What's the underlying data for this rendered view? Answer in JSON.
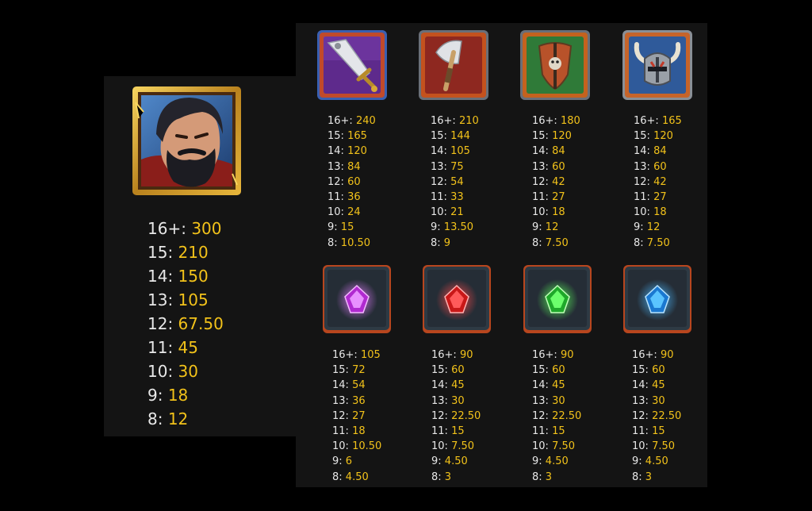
{
  "colors": {
    "background": "#000000",
    "panel": "#141414",
    "count_text": "#e8e8e8",
    "value_text": "#f2c21a"
  },
  "warrior": {
    "icon": "bearded-warrior-icon",
    "rows": [
      [
        "16+:",
        "300"
      ],
      [
        "15:",
        "210"
      ],
      [
        "14:",
        "150"
      ],
      [
        "13:",
        "105"
      ],
      [
        "12:",
        "67.50"
      ],
      [
        "11:",
        "45"
      ],
      [
        "10:",
        "30"
      ],
      [
        "9:",
        "18"
      ],
      [
        "8:",
        "12"
      ]
    ]
  },
  "top_symbols": [
    {
      "icon": "sword-icon",
      "rows": [
        [
          "16+:",
          "240"
        ],
        [
          "15:",
          "165"
        ],
        [
          "14:",
          "120"
        ],
        [
          "13:",
          "84"
        ],
        [
          "12:",
          "60"
        ],
        [
          "11:",
          "36"
        ],
        [
          "10:",
          "24"
        ],
        [
          "9:",
          "15"
        ],
        [
          "8:",
          "10.50"
        ]
      ]
    },
    {
      "icon": "axe-icon",
      "rows": [
        [
          "16+:",
          "210"
        ],
        [
          "15:",
          "144"
        ],
        [
          "14:",
          "105"
        ],
        [
          "13:",
          "75"
        ],
        [
          "12:",
          "54"
        ],
        [
          "11:",
          "33"
        ],
        [
          "10:",
          "21"
        ],
        [
          "9:",
          "13.50"
        ],
        [
          "8:",
          "9"
        ]
      ]
    },
    {
      "icon": "shield-icon",
      "rows": [
        [
          "16+:",
          "180"
        ],
        [
          "15:",
          "120"
        ],
        [
          "14:",
          "84"
        ],
        [
          "13:",
          "60"
        ],
        [
          "12:",
          "42"
        ],
        [
          "11:",
          "27"
        ],
        [
          "10:",
          "18"
        ],
        [
          "9:",
          "12"
        ],
        [
          "8:",
          "7.50"
        ]
      ]
    },
    {
      "icon": "horned-helmet-icon",
      "rows": [
        [
          "16+:",
          "165"
        ],
        [
          "15:",
          "120"
        ],
        [
          "14:",
          "84"
        ],
        [
          "13:",
          "60"
        ],
        [
          "12:",
          "42"
        ],
        [
          "11:",
          "27"
        ],
        [
          "10:",
          "18"
        ],
        [
          "9:",
          "12"
        ],
        [
          "8:",
          "7.50"
        ]
      ]
    }
  ],
  "gem_symbols": [
    {
      "icon": "purple-gem-icon",
      "rows": [
        [
          "16+:",
          "105"
        ],
        [
          "15:",
          "72"
        ],
        [
          "14:",
          "54"
        ],
        [
          "13:",
          "36"
        ],
        [
          "12:",
          "27"
        ],
        [
          "11:",
          "18"
        ],
        [
          "10:",
          "10.50"
        ],
        [
          "9:",
          "6"
        ],
        [
          "8:",
          "4.50"
        ]
      ]
    },
    {
      "icon": "red-gem-icon",
      "rows": [
        [
          "16+:",
          "90"
        ],
        [
          "15:",
          "60"
        ],
        [
          "14:",
          "45"
        ],
        [
          "13:",
          "30"
        ],
        [
          "12:",
          "22.50"
        ],
        [
          "11:",
          "15"
        ],
        [
          "10:",
          "7.50"
        ],
        [
          "9:",
          "4.50"
        ],
        [
          "8:",
          "3"
        ]
      ]
    },
    {
      "icon": "green-gem-icon",
      "rows": [
        [
          "16+:",
          "90"
        ],
        [
          "15:",
          "60"
        ],
        [
          "14:",
          "45"
        ],
        [
          "13:",
          "30"
        ],
        [
          "12:",
          "22.50"
        ],
        [
          "11:",
          "15"
        ],
        [
          "10:",
          "7.50"
        ],
        [
          "9:",
          "4.50"
        ],
        [
          "8:",
          "3"
        ]
      ]
    },
    {
      "icon": "blue-gem-icon",
      "rows": [
        [
          "16+:",
          "90"
        ],
        [
          "15:",
          "60"
        ],
        [
          "14:",
          "45"
        ],
        [
          "13:",
          "30"
        ],
        [
          "12:",
          "22.50"
        ],
        [
          "11:",
          "15"
        ],
        [
          "10:",
          "7.50"
        ],
        [
          "9:",
          "4.50"
        ],
        [
          "8:",
          "3"
        ]
      ]
    }
  ]
}
